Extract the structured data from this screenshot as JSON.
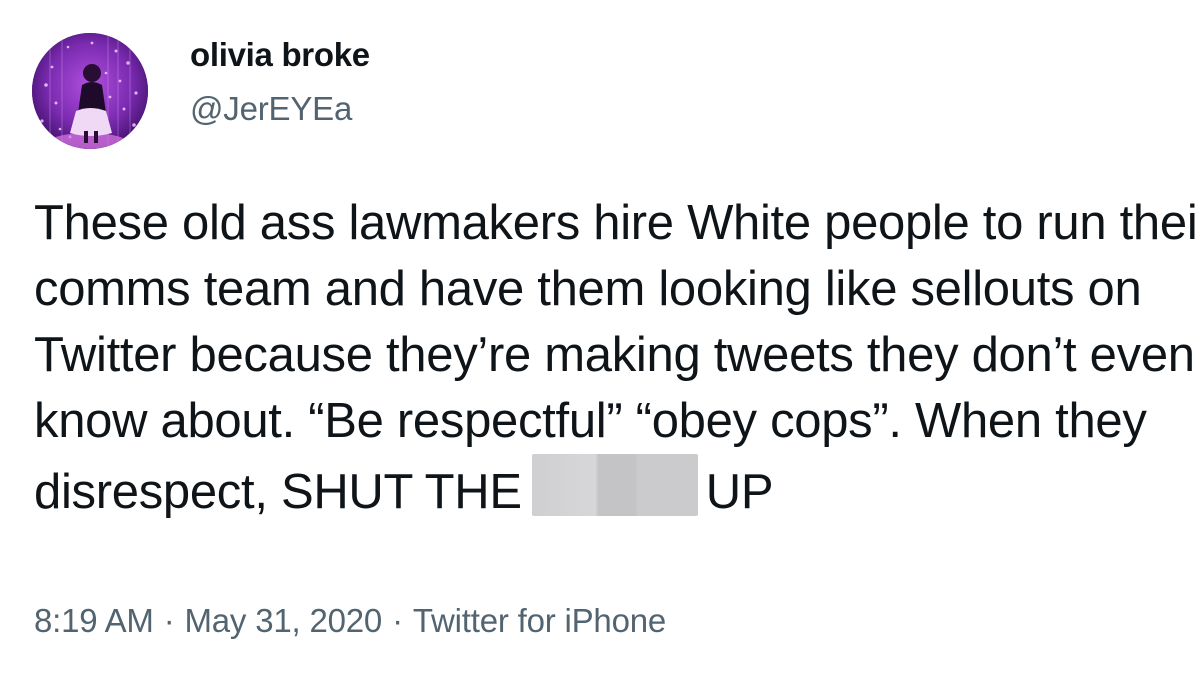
{
  "author": {
    "display_name": "olivia broke",
    "handle": "@JerEYEa"
  },
  "tweet": {
    "lines": [
      "These old ass lawmakers hire White people to run their",
      "comms team and have them looking like sellouts on",
      "Twitter because they’re making tweets they don’t even",
      "know about. “Be respectful” “obey cops”. When they",
      "disrespect, SHUT THE"
    ],
    "after_censor": "UP"
  },
  "meta": {
    "time": "8:19 AM",
    "separator": "·",
    "date": "May 31, 2020",
    "source": "Twitter for iPhone"
  },
  "colors": {
    "text": "#0f1419",
    "secondary": "#536471",
    "censor": "#c4c4c6",
    "avatar_bg": "#5a1b86"
  }
}
